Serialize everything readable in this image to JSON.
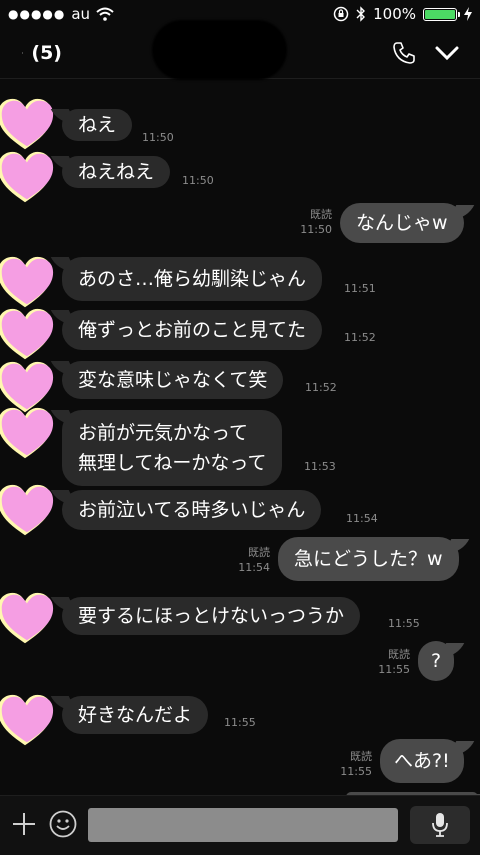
{
  "status_bar": {
    "signal": "●●●●●",
    "carrier": "au",
    "battery": "100%"
  },
  "header": {
    "back_count": "(5)",
    "icons": {
      "back": "chevron-left-icon",
      "call": "phone-icon",
      "menu": "chevron-down-icon"
    }
  },
  "messages": [
    {
      "side": "in",
      "text": "ねえ",
      "time": "11:50"
    },
    {
      "side": "in",
      "text": "ねえねえ",
      "time": "11:50"
    },
    {
      "side": "out",
      "text": "なんじゃw",
      "read": "既読",
      "time": "11:50"
    },
    {
      "side": "in",
      "text": "あのさ…俺ら幼馴染じゃん",
      "time": "11:51"
    },
    {
      "side": "in",
      "text": "俺ずっとお前のこと見てた",
      "time": "11:52"
    },
    {
      "side": "in",
      "text": "変な意味じゃなくて笑",
      "time": "11:52"
    },
    {
      "side": "in",
      "text_lines": [
        "お前が元気かなって",
        "無理してねーかなって"
      ],
      "time": "11:53"
    },
    {
      "side": "in",
      "text": "お前泣いてる時多いじゃん",
      "time": "11:54"
    },
    {
      "side": "out",
      "text": "急にどうした？w",
      "read": "既読",
      "time": "11:54"
    },
    {
      "side": "in",
      "text": "要するにほっとけないっつうか",
      "time": "11:55"
    },
    {
      "side": "out",
      "text": "?",
      "read": "既読",
      "time": "11:55"
    },
    {
      "side": "in",
      "text": "好きなんだよ",
      "time": "11:55"
    },
    {
      "side": "out",
      "text": "へあ?!",
      "read": "既読",
      "time": "11:55"
    }
  ],
  "colors": {
    "background": "#0b0b0b",
    "incoming": "#2a2a2a",
    "outgoing": "#4a4a4a",
    "avatar": "#f59ee3",
    "battery": "#4cd964"
  },
  "bottom_bar": {
    "icons": [
      "plus-icon",
      "emoji-icon",
      "microphone-icon"
    ]
  }
}
